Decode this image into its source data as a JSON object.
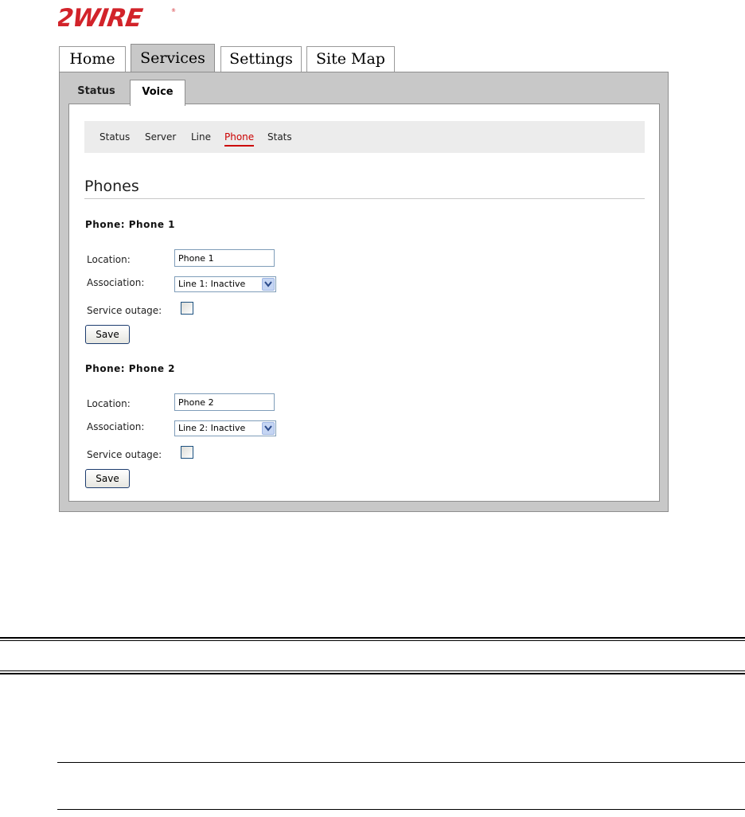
{
  "logo": {
    "text": "2WIRE",
    "color": "#d2232a"
  },
  "main_tabs": [
    {
      "label": "Home"
    },
    {
      "label": "Services"
    },
    {
      "label": "Settings"
    },
    {
      "label": "Site Map"
    }
  ],
  "main_tabs_active": "Services",
  "sub_tabs": [
    {
      "label": "Status"
    },
    {
      "label": "Voice"
    }
  ],
  "sub_tabs_active": "Voice",
  "subnav": [
    {
      "label": "Status"
    },
    {
      "label": "Server"
    },
    {
      "label": "Line"
    },
    {
      "label": "Phone"
    },
    {
      "label": "Stats"
    }
  ],
  "subnav_active": "Phone",
  "accent_color": "#cc0000",
  "page_title": "Phones",
  "phones": [
    {
      "heading": "Phone: Phone 1",
      "location_label": "Location:",
      "location_value": "Phone 1",
      "association_label": "Association:",
      "association_value": "Line 1: Inactive",
      "outage_label": "Service outage:",
      "outage_checked": false,
      "save_label": "Save"
    },
    {
      "heading": "Phone: Phone 2",
      "location_label": "Location:",
      "location_value": "Phone 2",
      "association_label": "Association:",
      "association_value": "Line 2: Inactive",
      "outage_label": "Service outage:",
      "outage_checked": false,
      "save_label": "Save"
    }
  ]
}
